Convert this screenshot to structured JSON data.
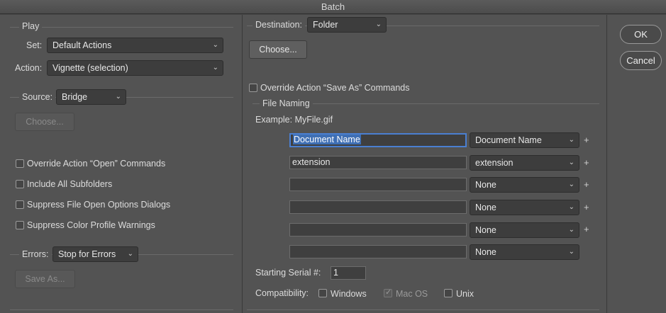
{
  "window": {
    "title": "Batch"
  },
  "play": {
    "group_label": "Play",
    "set_label": "Set:",
    "set_value": "Default Actions",
    "action_label": "Action:",
    "action_value": "Vignette (selection)"
  },
  "source": {
    "label": "Source:",
    "value": "Bridge",
    "choose_label": "Choose...",
    "checkboxes": [
      {
        "label": "Override Action “Open” Commands",
        "checked": false
      },
      {
        "label": "Include All Subfolders",
        "checked": false
      },
      {
        "label": "Suppress File Open Options Dialogs",
        "checked": false
      },
      {
        "label": "Suppress Color Profile Warnings",
        "checked": false
      }
    ]
  },
  "errors": {
    "label": "Errors:",
    "value": "Stop for Errors",
    "save_as_label": "Save As..."
  },
  "destination": {
    "label": "Destination:",
    "value": "Folder",
    "choose_label": "Choose...",
    "override_label": "Override Action “Save As” Commands"
  },
  "file_naming": {
    "group_label": "File Naming",
    "example": "Example: MyFile.gif",
    "rows": [
      {
        "input": "Document Name",
        "select": "Document Name",
        "plus": "+"
      },
      {
        "input": "extension",
        "select": "extension",
        "plus": "+"
      },
      {
        "input": "",
        "select": "None",
        "plus": "+"
      },
      {
        "input": "",
        "select": "None",
        "plus": "+"
      },
      {
        "input": "",
        "select": "None",
        "plus": "+"
      },
      {
        "input": "",
        "select": "None",
        "plus": ""
      }
    ],
    "serial_label": "Starting Serial #:",
    "serial_value": "1",
    "compat_label": "Compatibility:",
    "compat": [
      {
        "label": "Windows",
        "checked": false
      },
      {
        "label": "Mac OS",
        "checked": true,
        "disabled": true
      },
      {
        "label": "Unix",
        "checked": false
      }
    ]
  },
  "buttons": {
    "ok": "OK",
    "cancel": "Cancel"
  },
  "icons": {
    "dropdown": "chevron-down-icon",
    "chevron_glyph": "⌄"
  }
}
